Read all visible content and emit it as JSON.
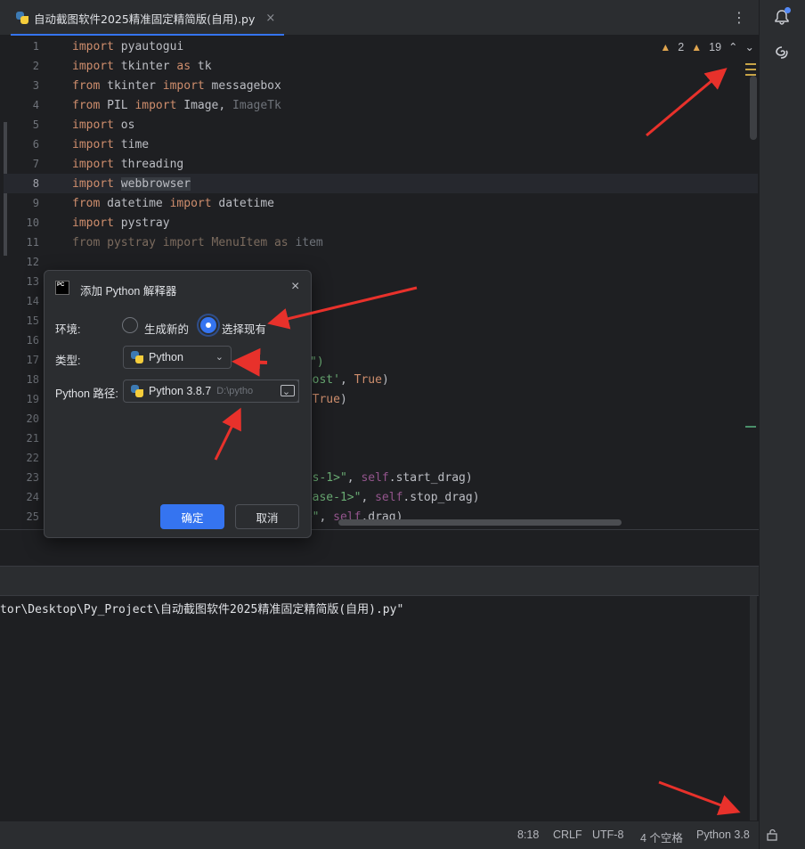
{
  "tab": {
    "title": "自动截图软件2025精准固定精简版(自用).py",
    "close": "×",
    "menu": "⋮"
  },
  "inspections": {
    "warnings": "2",
    "weak_warnings": "19"
  },
  "code_lines": [
    {
      "n": "1"
    },
    {
      "n": "2"
    },
    {
      "n": "3"
    },
    {
      "n": "4"
    },
    {
      "n": "5"
    },
    {
      "n": "6"
    },
    {
      "n": "7"
    },
    {
      "n": "8"
    },
    {
      "n": "9"
    },
    {
      "n": "10"
    },
    {
      "n": "11"
    },
    {
      "n": "12"
    },
    {
      "n": "13"
    },
    {
      "n": "14"
    },
    {
      "n": "15"
    },
    {
      "n": "16"
    },
    {
      "n": "17"
    },
    {
      "n": "18"
    },
    {
      "n": "19"
    },
    {
      "n": "20"
    },
    {
      "n": "21"
    },
    {
      "n": "22"
    },
    {
      "n": "23"
    },
    {
      "n": "24"
    },
    {
      "n": "25"
    }
  ],
  "code": {
    "l1": [
      "import",
      " pyautogui"
    ],
    "l2": [
      "import",
      " tkinter ",
      "as",
      " tk"
    ],
    "l3": [
      "from",
      " tkinter ",
      "import",
      " messagebox"
    ],
    "l4": [
      "from",
      " PIL ",
      "import",
      " Image, ",
      "ImageTk"
    ],
    "l5": [
      "import",
      " os"
    ],
    "l6": [
      "import",
      " time"
    ],
    "l7": [
      "import",
      " threading"
    ],
    "l8": [
      "import",
      " ",
      "webbrowser"
    ],
    "l9": [
      "from",
      " datetime ",
      "import",
      " datetime"
    ],
    "l10": [
      "import",
      " pystray"
    ],
    "l11": [
      "from pystray import MenuItem as ",
      "item"
    ],
    "l17": [
      "件\")"
    ],
    "l18": [
      "pmost'",
      ", ",
      "True",
      ")"
    ],
    "l19": [
      "t(",
      "True",
      ")"
    ],
    "l23": [
      "ess-1>\"",
      ", ",
      "self",
      ".start_drag)"
    ],
    "l24": [
      "lease-1>\"",
      ", ",
      "self",
      ".stop_drag)"
    ],
    "l25": [
      "n>\"",
      ", ",
      "self",
      ".drag)"
    ]
  },
  "terminal": {
    "line": "tor\\Desktop\\Py_Project\\自动截图软件2025精准固定精简版(自用).py\""
  },
  "status": {
    "position": "8:18",
    "line_sep": "CRLF",
    "encoding": "UTF-8",
    "indent": "4 个空格",
    "interpreter": "Python 3.8"
  },
  "dialog": {
    "logo": "PC",
    "title": "添加 Python 解释器",
    "close": "×",
    "env_label": "环境:",
    "env_new": "生成新的",
    "env_existing": "选择现有",
    "env_selected": "选择现有",
    "type_label": "类型:",
    "type_value": "Python",
    "path_label": "Python 路径:",
    "path_value": "Python 3.8.7",
    "path_dim": "D:\\pytho",
    "ok": "确定",
    "cancel": "取消"
  },
  "colors": {
    "accent": "#3574f0",
    "keyword": "#cf8e6d",
    "string": "#6aab73",
    "self": "#94558d",
    "annotation_arrow": "#e8312b"
  }
}
